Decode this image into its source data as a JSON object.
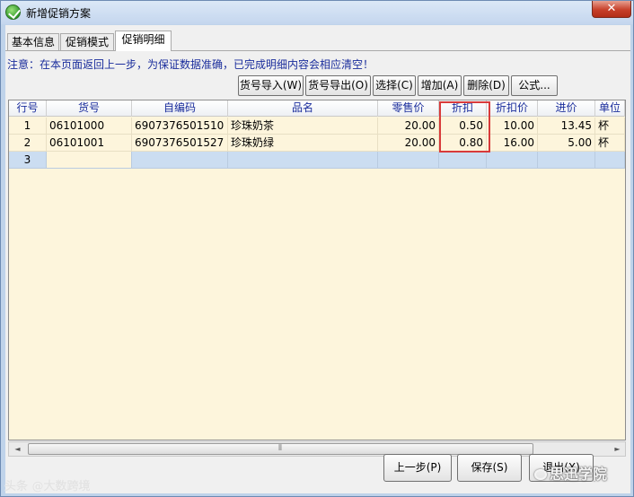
{
  "window": {
    "title": "新增促销方案",
    "close_symbol": "✕"
  },
  "tabs": [
    {
      "label": "基本信息"
    },
    {
      "label": "促销模式"
    },
    {
      "label": "促销明细"
    }
  ],
  "notice": "注意：在本页面返回上一步，为保证数据准确，已完成明细内容会相应清空！",
  "toolbar": {
    "import_label": "货号导入(W)",
    "export_label": "货号导出(O)",
    "select_label": "选择(C)",
    "add_label": "增加(A)",
    "delete_label": "删除(D)",
    "formula_label": "公式..."
  },
  "grid": {
    "columns": [
      "行号",
      "货号",
      "自编码",
      "品名",
      "零售价",
      "折扣",
      "折扣价",
      "进价",
      "单位"
    ],
    "rows": [
      {
        "line": "1",
        "item_no": "06101000",
        "code": "6907376501510",
        "name": "珍珠奶茶",
        "retail_price": "20.00",
        "discount": "0.50",
        "discount_price": "10.00",
        "cost": "13.45",
        "unit": "杯"
      },
      {
        "line": "2",
        "item_no": "06101001",
        "code": "6907376501527",
        "name": "珍珠奶绿",
        "retail_price": "20.00",
        "discount": "0.80",
        "discount_price": "16.00",
        "cost": "5.00",
        "unit": "杯"
      },
      {
        "line": "3",
        "item_no": "",
        "code": "",
        "name": "",
        "retail_price": "",
        "discount": "",
        "discount_price": "",
        "cost": "",
        "unit": ""
      }
    ],
    "scroll_left": "◄",
    "scroll_right": "►",
    "scroll_grip": "⦀"
  },
  "footer": {
    "prev_label": "上一步(P)",
    "save_label": "保存(S)",
    "exit_label": "退出(X)"
  },
  "watermarks": {
    "left": "头条 @大数跨境",
    "right": "思迅学院"
  },
  "colors": {
    "grid_bg": "#fdf5dc",
    "selected_row": "#cbddf1",
    "header_text": "#1a2d9c",
    "highlight": "#d83a3a"
  }
}
